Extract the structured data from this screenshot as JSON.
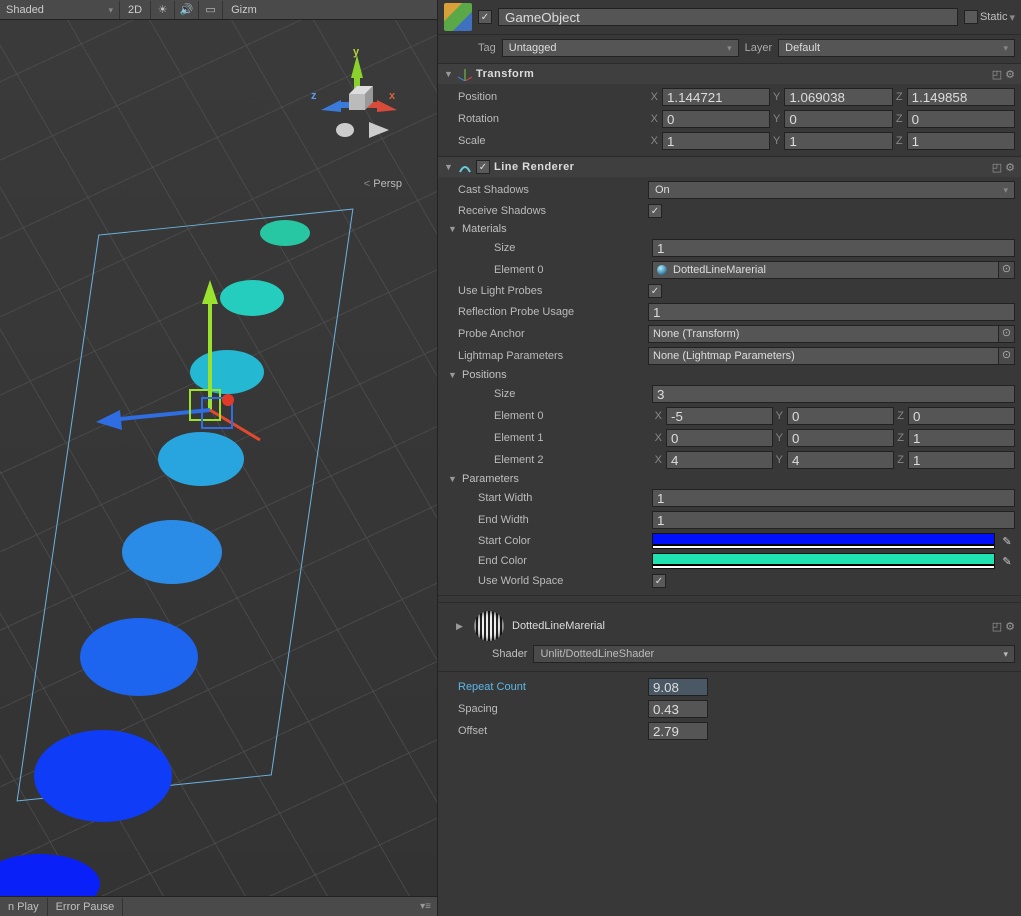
{
  "scene": {
    "shading": "Shaded",
    "twoD": "2D",
    "gizmos": "Gizm",
    "persp": "Persp",
    "bottom_tabs": [
      "n Play",
      "Error Pause"
    ]
  },
  "header": {
    "enabled": true,
    "name": "GameObject",
    "static_label": "Static",
    "tag_label": "Tag",
    "tag_value": "Untagged",
    "layer_label": "Layer",
    "layer_value": "Default"
  },
  "transform": {
    "title": "Transform",
    "position_label": "Position",
    "position": {
      "x": "1.144721",
      "y": "1.069038",
      "z": "1.149858"
    },
    "rotation_label": "Rotation",
    "rotation": {
      "x": "0",
      "y": "0",
      "z": "0"
    },
    "scale_label": "Scale",
    "scale": {
      "x": "1",
      "y": "1",
      "z": "1"
    }
  },
  "line": {
    "title": "Line Renderer",
    "cast_label": "Cast Shadows",
    "cast_value": "On",
    "recv_label": "Receive Shadows",
    "recv_value": true,
    "materials_label": "Materials",
    "mat_size_label": "Size",
    "mat_size": "1",
    "mat_el0_label": "Element 0",
    "mat_el0": "DottedLineMarerial",
    "probes_label": "Use Light Probes",
    "probes_value": true,
    "refl_label": "Reflection Probe Usage",
    "refl_value": "1",
    "anchor_label": "Probe Anchor",
    "anchor_value": "None (Transform)",
    "lightmap_label": "Lightmap Parameters",
    "lightmap_value": "None (Lightmap Parameters)",
    "positions_label": "Positions",
    "pos_size_label": "Size",
    "pos_size": "3",
    "pos0_label": "Element 0",
    "pos0": {
      "x": "-5",
      "y": "0",
      "z": "0"
    },
    "pos1_label": "Element 1",
    "pos1": {
      "x": "0",
      "y": "0",
      "z": "1"
    },
    "pos2_label": "Element 2",
    "pos2": {
      "x": "4",
      "y": "4",
      "z": "1"
    },
    "params_label": "Parameters",
    "sw_label": "Start Width",
    "sw": "1",
    "ew_label": "End Width",
    "ew": "1",
    "sc_label": "Start Color",
    "sc": "#0010ff",
    "ec_label": "End Color",
    "ec": "#1ee2b0",
    "uws_label": "Use World Space",
    "uws": true
  },
  "material": {
    "name": "DottedLineMarerial",
    "shader_label": "Shader",
    "shader_value": "Unlit/DottedLineShader",
    "repeat_label": "Repeat Count",
    "repeat": "9.08",
    "spacing_label": "Spacing",
    "spacing": "0.43",
    "offset_label": "Offset",
    "offset": "2.79"
  },
  "axes": {
    "x": "X",
    "y": "Y",
    "z": "Z"
  },
  "gizmo": {
    "x": "x",
    "y": "y",
    "z": "z"
  }
}
